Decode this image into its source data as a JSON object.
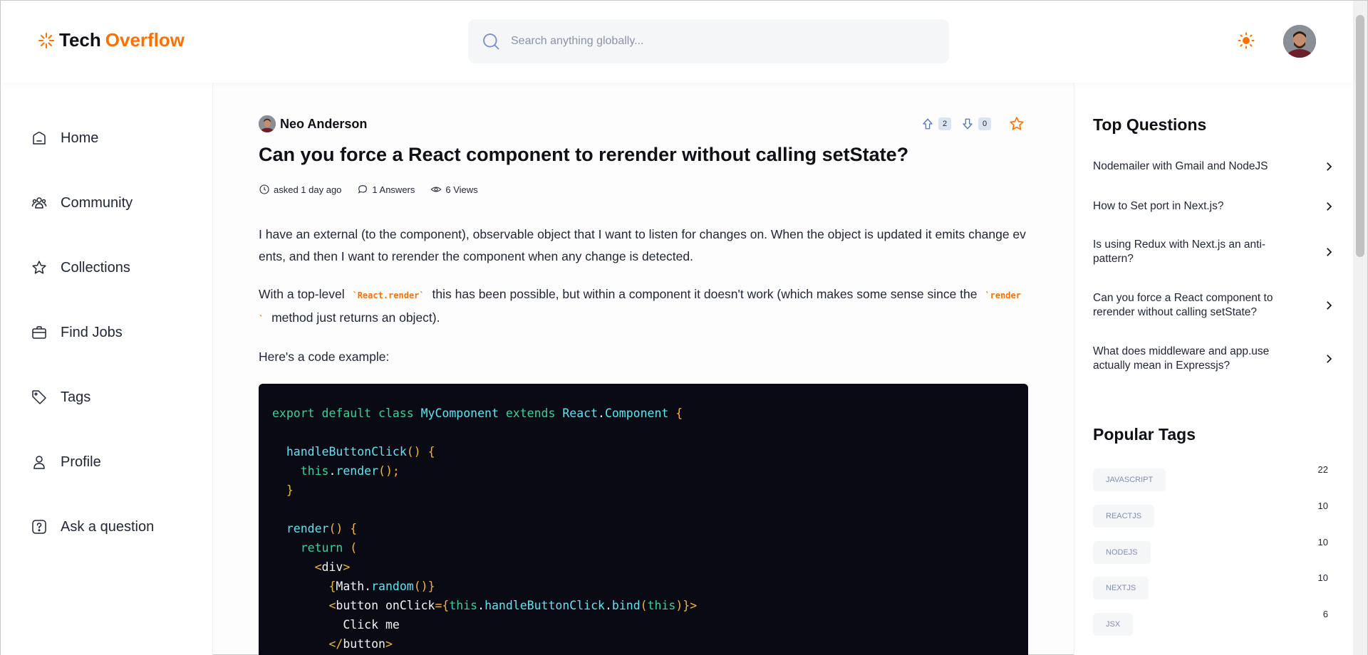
{
  "app": {
    "logo_text_1": "Tech",
    "logo_text_2": "Overflow",
    "search_placeholder": "Search anything globally...",
    "accent_color": "#ff7000"
  },
  "sidebar": {
    "items": [
      {
        "label": "Home",
        "icon": "home-icon"
      },
      {
        "label": "Community",
        "icon": "users-icon"
      },
      {
        "label": "Collections",
        "icon": "star-icon"
      },
      {
        "label": "Find Jobs",
        "icon": "briefcase-icon"
      },
      {
        "label": "Tags",
        "icon": "tag-icon"
      },
      {
        "label": "Profile",
        "icon": "user-icon"
      },
      {
        "label": "Ask a question",
        "icon": "question-icon"
      }
    ]
  },
  "question": {
    "author": "Neo Anderson",
    "upvotes": "2",
    "downvotes": "0",
    "title": "Can you force a React component to rerender without calling setState?",
    "asked": "asked 1 day ago",
    "answers": "1 Answers",
    "views": "6 Views",
    "p1": "I have an external (to the component), observable object that I want to listen for changes on. When the object is updated it emits change events, and then I want to rerender the component when any change is detected.",
    "p2_a": "With a top-level",
    "p2_code1": "`React.render`",
    "p2_b": "this has been possible, but within a component it doesn't work (which makes some sense since the",
    "p2_code2": "`render`",
    "p2_c": "method just returns an object).",
    "p3": "Here's a code example:"
  },
  "right": {
    "top_questions_title": "Top Questions",
    "top_questions": [
      "Nodemailer with Gmail and NodeJS",
      "How to Set port in Next.js?",
      "Is using Redux with Next.js an anti-pattern?",
      "Can you force a React component to rerender without calling setState?",
      "What does middleware and app.use actually mean in Expressjs?"
    ],
    "popular_tags_title": "Popular Tags",
    "tags": [
      {
        "name": "JAVASCRIPT",
        "count": "22"
      },
      {
        "name": "REACTJS",
        "count": "10"
      },
      {
        "name": "NODEJS",
        "count": "10"
      },
      {
        "name": "NEXTJS",
        "count": "10"
      },
      {
        "name": "JSX",
        "count": "6"
      }
    ]
  }
}
